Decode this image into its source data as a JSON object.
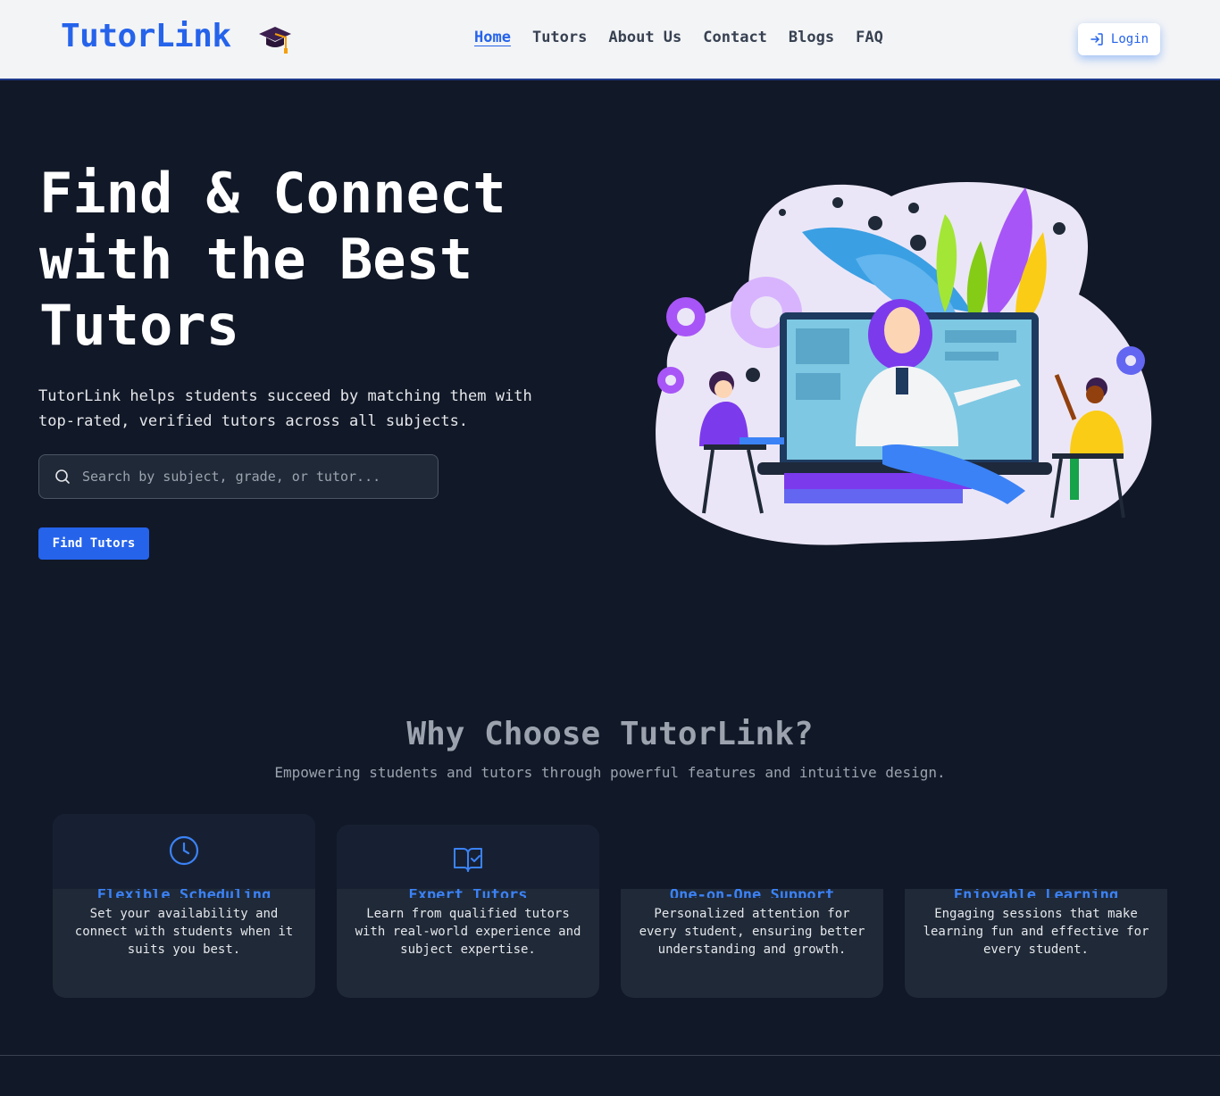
{
  "navbar": {
    "brand": "TutorLink",
    "brand_icon": "graduation-cap-icon",
    "links": [
      {
        "label": "Home",
        "active": true
      },
      {
        "label": "Tutors",
        "active": false
      },
      {
        "label": "About Us",
        "active": false
      },
      {
        "label": "Contact",
        "active": false
      },
      {
        "label": "Blogs",
        "active": false
      },
      {
        "label": "FAQ",
        "active": false
      }
    ],
    "login_label": "Login",
    "login_icon": "login-arrow-icon"
  },
  "hero": {
    "title_lines": [
      "Find & Connect",
      "with the Best",
      "Tutors"
    ],
    "description_lines": [
      "TutorLink helps students succeed by matching them with",
      "top-rated, verified tutors across all subjects."
    ],
    "search_placeholder": "Search by subject, grade, or tutor...",
    "search_icon": "search-icon",
    "cta_label": "Find Tutors",
    "illustration": "online-tutoring-illustration"
  },
  "why": {
    "title": "Why Choose TutorLink?",
    "subtitle": "Empowering students and tutors through powerful features and intuitive design.",
    "cards": [
      {
        "icon": "clock-icon",
        "title": "Flexible Scheduling",
        "description": "Set your availability and connect with students when it suits you best."
      },
      {
        "icon": "book-check-icon",
        "title": "Expert Tutors",
        "description": "Learn from qualified tutors with real-world experience and subject expertise."
      },
      {
        "icon": "",
        "title": "One-on-One Support",
        "description": "Personalized attention for every student, ensuring better understanding and growth."
      },
      {
        "icon": "",
        "title": "Enjoyable Learning",
        "description": "Engaging sessions that make learning fun and effective for every student."
      }
    ]
  },
  "colors": {
    "brand": "#2563eb",
    "background": "#111827",
    "card": "#1f2937",
    "navbar": "#f3f4f6"
  }
}
